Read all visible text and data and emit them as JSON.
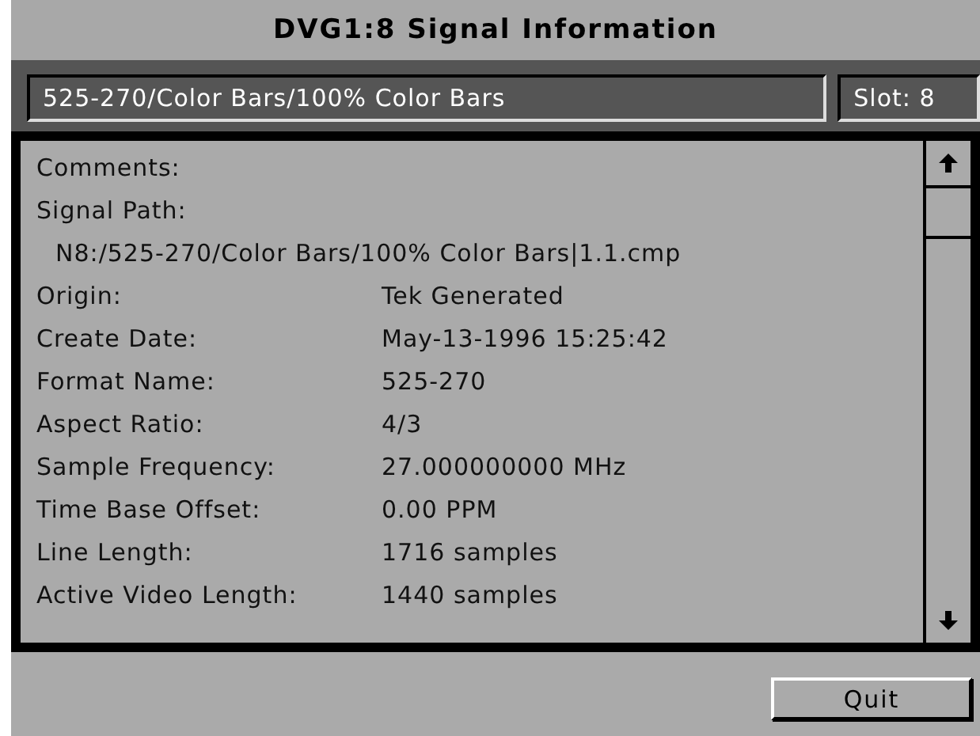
{
  "window": {
    "title": "DVG1:8  Signal Information"
  },
  "header": {
    "signal": "525-270/Color Bars/100%  Color Bars",
    "slot": "Slot: 8"
  },
  "rows": [
    {
      "kind": "pair",
      "label": "Comments:"
    },
    {
      "kind": "pair",
      "label": "Signal Path:"
    },
    {
      "kind": "block",
      "value": "N8:/525-270/Color Bars/100%  Color Bars|1.1.cmp"
    },
    {
      "kind": "pair",
      "label": "Origin:",
      "value": "Tek Generated"
    },
    {
      "kind": "pair",
      "label": "Create Date:",
      "value": "May-13-1996  15:25:42"
    },
    {
      "kind": "pair",
      "label": "Format Name:",
      "value": "525-270"
    },
    {
      "kind": "pair",
      "label": "Aspect Ratio:",
      "value": "4/3"
    },
    {
      "kind": "pair",
      "label": "Sample Frequency:",
      "value": "27.000000000 MHz"
    },
    {
      "kind": "pair",
      "label": "Time Base Offset:",
      "value": "0.00 PPM"
    },
    {
      "kind": "pair",
      "label": "Line Length:",
      "value": "1716 samples"
    },
    {
      "kind": "pair",
      "label": "Active Video Length:",
      "value": "1440 samples"
    }
  ],
  "buttons": [
    "Quit"
  ]
}
